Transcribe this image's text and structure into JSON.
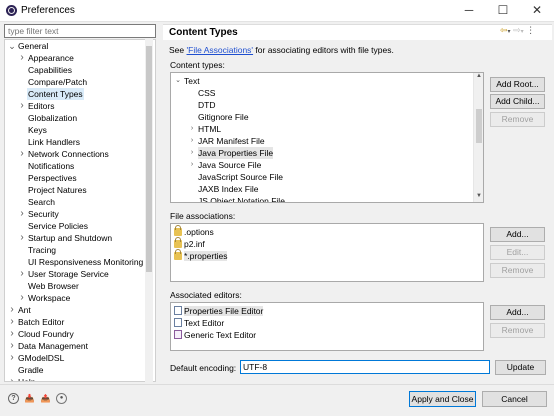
{
  "window": {
    "title": "Preferences",
    "minimize_glyph": "─",
    "maximize_glyph": "☐",
    "close_glyph": "✕"
  },
  "filter": {
    "placeholder": "type filter text"
  },
  "tree": [
    {
      "label": "General",
      "level": 0,
      "twisty": "expanded"
    },
    {
      "label": "Appearance",
      "level": 1,
      "twisty": "collapsed"
    },
    {
      "label": "Capabilities",
      "level": 1,
      "twisty": "none"
    },
    {
      "label": "Compare/Patch",
      "level": 1,
      "twisty": "none"
    },
    {
      "label": "Content Types",
      "level": 1,
      "twisty": "none",
      "selected": true
    },
    {
      "label": "Editors",
      "level": 1,
      "twisty": "collapsed"
    },
    {
      "label": "Globalization",
      "level": 1,
      "twisty": "none"
    },
    {
      "label": "Keys",
      "level": 1,
      "twisty": "none"
    },
    {
      "label": "Link Handlers",
      "level": 1,
      "twisty": "none"
    },
    {
      "label": "Network Connections",
      "level": 1,
      "twisty": "collapsed"
    },
    {
      "label": "Notifications",
      "level": 1,
      "twisty": "none"
    },
    {
      "label": "Perspectives",
      "level": 1,
      "twisty": "none"
    },
    {
      "label": "Project Natures",
      "level": 1,
      "twisty": "none"
    },
    {
      "label": "Search",
      "level": 1,
      "twisty": "none"
    },
    {
      "label": "Security",
      "level": 1,
      "twisty": "collapsed"
    },
    {
      "label": "Service Policies",
      "level": 1,
      "twisty": "none"
    },
    {
      "label": "Startup and Shutdown",
      "level": 1,
      "twisty": "collapsed"
    },
    {
      "label": "Tracing",
      "level": 1,
      "twisty": "none"
    },
    {
      "label": "UI Responsiveness Monitoring",
      "level": 1,
      "twisty": "none"
    },
    {
      "label": "User Storage Service",
      "level": 1,
      "twisty": "collapsed"
    },
    {
      "label": "Web Browser",
      "level": 1,
      "twisty": "none"
    },
    {
      "label": "Workspace",
      "level": 1,
      "twisty": "collapsed"
    },
    {
      "label": "Ant",
      "level": 0,
      "twisty": "collapsed"
    },
    {
      "label": "Batch Editor",
      "level": 0,
      "twisty": "collapsed"
    },
    {
      "label": "Cloud Foundry",
      "level": 0,
      "twisty": "collapsed"
    },
    {
      "label": "Data Management",
      "level": 0,
      "twisty": "collapsed"
    },
    {
      "label": "GModelDSL",
      "level": 0,
      "twisty": "collapsed"
    },
    {
      "label": "Gradle",
      "level": 0,
      "twisty": "none"
    },
    {
      "label": "Help",
      "level": 0,
      "twisty": "collapsed"
    }
  ],
  "page": {
    "title": "Content Types",
    "see_prefix": "See ",
    "see_link": "'File Associations'",
    "see_suffix": " for associating editors with file types.",
    "content_types_label": "Content types:",
    "file_assoc_label": "File associations:",
    "assoc_editors_label": "Associated editors:",
    "encoding_label": "Default encoding:",
    "encoding_value": "UTF-8"
  },
  "content_types": [
    {
      "label": "Text",
      "level": 0,
      "twisty": "expanded"
    },
    {
      "label": "CSS",
      "level": 1,
      "twisty": "none"
    },
    {
      "label": "DTD",
      "level": 1,
      "twisty": "none"
    },
    {
      "label": "Gitignore File",
      "level": 1,
      "twisty": "none"
    },
    {
      "label": "HTML",
      "level": 1,
      "twisty": "collapsed"
    },
    {
      "label": "JAR Manifest File",
      "level": 1,
      "twisty": "collapsed"
    },
    {
      "label": "Java Properties File",
      "level": 1,
      "twisty": "collapsed",
      "selected": true
    },
    {
      "label": "Java Source File",
      "level": 1,
      "twisty": "collapsed"
    },
    {
      "label": "JavaScript Source File",
      "level": 1,
      "twisty": "none"
    },
    {
      "label": "JAXB Index File",
      "level": 1,
      "twisty": "none"
    },
    {
      "label": "JS Object Notation File",
      "level": 1,
      "twisty": "none"
    }
  ],
  "file_associations": [
    {
      "label": ".options"
    },
    {
      "label": "p2.inf"
    },
    {
      "label": "*.properties",
      "selected": true
    }
  ],
  "associated_editors": [
    {
      "label": "Properties File Editor",
      "icon": "properties-editor-icon",
      "selected": true
    },
    {
      "label": "Text Editor",
      "icon": "text-editor-icon"
    },
    {
      "label": "Generic Text Editor",
      "icon": "generic-editor-icon"
    }
  ],
  "buttons": {
    "add_root": "Add Root...",
    "add_child": "Add Child...",
    "remove_ct": "Remove",
    "add_fa": "Add...",
    "edit_fa": "Edit...",
    "remove_fa": "Remove",
    "add_ed": "Add...",
    "remove_ed": "Remove",
    "update": "Update",
    "apply_close": "Apply and Close",
    "cancel": "Cancel"
  },
  "bottom_icons": [
    "help-icon",
    "import-icon",
    "export-icon",
    "oomph-icon"
  ],
  "colors": {
    "link": "#1f4fd0",
    "selection": "#d9ebf9",
    "focus": "#0078d7"
  }
}
